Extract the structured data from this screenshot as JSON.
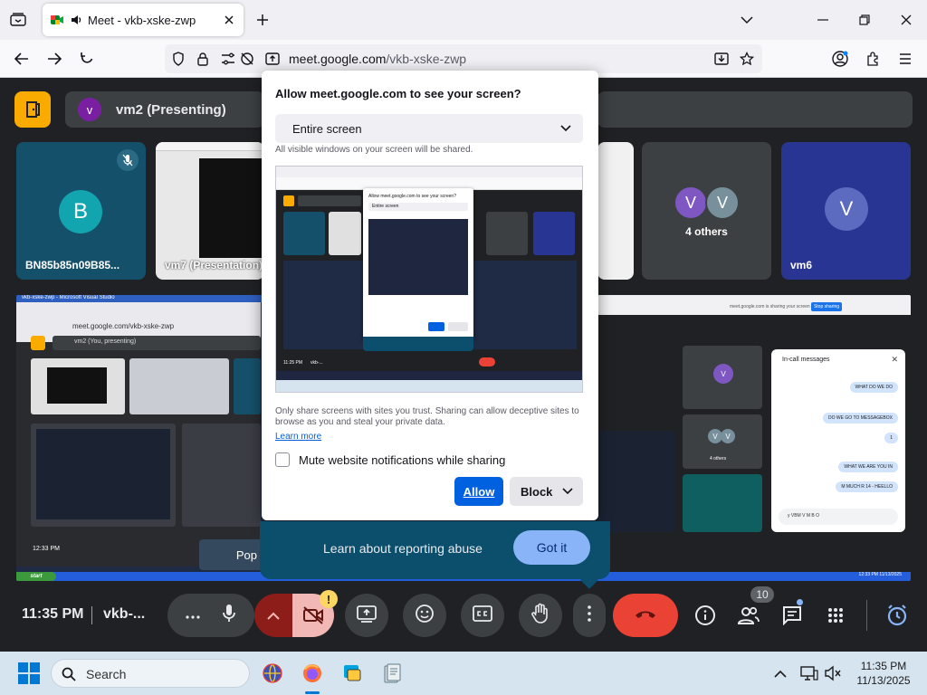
{
  "browser": {
    "tab_title": "Meet - vkb-xske-zwp",
    "url_domain": "meet.google.com",
    "url_path": "/vkb-xske-zwp"
  },
  "meet": {
    "presenting_chip_initial": "v",
    "presenting_label": "vm2 (Presenting)",
    "tiles": {
      "b_initial": "B",
      "b_name": "BN85b85n09B85...",
      "vm7_name": "vm7 (Presentation)",
      "others_initial_1": "V",
      "others_initial_2": "V",
      "others_label": "4 others",
      "vm6_initial": "V",
      "vm6_name": "vm6"
    },
    "shared_screen": {
      "xp_title": "vkb-xske-zwp - Microsoft Visual Studio",
      "mini_url": "meet.google.com/vkb-xske-zwp",
      "mini_chip": "vm2 (You, presenting)",
      "pop_label": "Pop",
      "mini_time": "12:33 PM",
      "right_chrome_text": "meet.google.com is sharing your screen",
      "stop_sharing": "Stop sharing",
      "others_label": "4 others",
      "chat_title": "In-call messages",
      "chat_messages": [
        "WHAT DO WE DO",
        "DO WE GO TO MESSAGEBOX",
        "1",
        "WHAT WE ARE YOU IN",
        "M MUCH R 14 - HEELLO"
      ],
      "chat_input": "y VBM V M B O",
      "xp_start": "start",
      "xp_clock": "12:33 PM 11/13/2025",
      "right_time": "12:33 PM"
    },
    "bottom_bar": {
      "time": "11:35 PM",
      "meeting_code": "vkb-...",
      "participant_count": "10",
      "cam_warning": "!"
    }
  },
  "permission_dialog": {
    "title": "Allow meet.google.com to see your screen?",
    "selected_source": "Entire screen",
    "hint": "All visible windows on your screen will be shared.",
    "warning": "Only share screens with sites you trust. Sharing can allow deceptive sites to browse as you and steal your private data.",
    "learn_more": "Learn more",
    "mute_label": "Mute website notifications while sharing",
    "mute_checked": false,
    "allow_label": "Allow",
    "block_label": "Block",
    "preview": {
      "tiny_title": "Allow meet.google.com to see your screen?",
      "tiny_option": "Entire screen",
      "tiny_time": "11:25 PM",
      "tiny_code": "vkb-..."
    }
  },
  "abuse_banner": {
    "text": "Learn about reporting abuse",
    "button": "Got it"
  },
  "taskbar": {
    "search_placeholder": "Search",
    "time": "11:35 PM",
    "date": "11/13/2025"
  },
  "colors": {
    "meet_bg": "#202124",
    "end_call": "#ea4335",
    "allow_blue": "#0061e0",
    "banner_teal": "#0b4f6c",
    "got_it": "#8ab4f8",
    "meet_logo": "#f9ab00"
  },
  "icons": [
    "tab-list-icon",
    "meet-favicon-icon",
    "speaker-icon",
    "close-icon",
    "plus-icon",
    "chevron-down-icon",
    "minimize-icon",
    "maximize-icon",
    "window-close-icon",
    "back-icon",
    "forward-icon",
    "reload-icon",
    "shield-icon",
    "lock-icon",
    "permissions-icon",
    "camera-off-icon",
    "screen-share-icon",
    "download-icon",
    "star-icon",
    "account-icon",
    "extensions-icon",
    "menu-icon",
    "door-icon",
    "mic-off-icon",
    "more-icon",
    "mic-icon",
    "chevron-up-icon",
    "present-icon",
    "emoji-icon",
    "captions-icon",
    "hand-icon",
    "more-vert-icon",
    "end-call-icon",
    "info-icon",
    "people-icon",
    "chat-icon",
    "apps-icon",
    "timer-icon",
    "windows-icon",
    "search-icon",
    "globe-icon",
    "firefox-icon",
    "app-icon",
    "files-icon",
    "chevron-up-tray-icon",
    "display-icon",
    "mute-speaker-icon"
  ]
}
